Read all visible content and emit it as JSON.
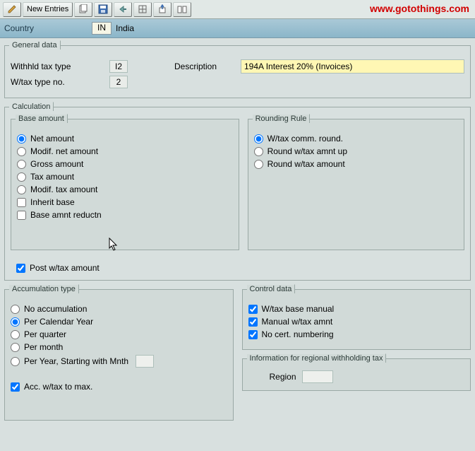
{
  "toolbar": {
    "new_entries": "New Entries"
  },
  "watermark": "www.gotothings.com",
  "countrybar": {
    "label": "Country",
    "code": "IN",
    "name": "India"
  },
  "general": {
    "legend": "General data",
    "withhld_label": "Withhld tax type",
    "withhld_value": "I2",
    "wtaxno_label": "W/tax type no.",
    "wtaxno_value": "2",
    "desc_label": "Description",
    "desc_value": "194A Interest 20% (Invoices)"
  },
  "calc": {
    "legend": "Calculation",
    "base": {
      "legend": "Base amount",
      "options": [
        "Net amount",
        "Modif. net amount",
        "Gross amount",
        "Tax amount",
        "Modif. tax amount"
      ],
      "inherit_label": "Inherit base",
      "reductn_label": "Base amnt reductn"
    },
    "rounding": {
      "legend": "Rounding Rule",
      "options": [
        "W/tax comm. round.",
        "Round w/tax amnt up",
        "Round w/tax amount"
      ]
    },
    "post_label": "Post w/tax amount"
  },
  "accum": {
    "legend": "Accumulation type",
    "options": [
      "No accumulation",
      "Per Calendar Year",
      "Per quarter",
      "Per month",
      "Per Year, Starting with Mnth"
    ],
    "acc_max_label": "Acc. w/tax to max."
  },
  "control": {
    "legend": "Control data",
    "wtax_base_manual": "W/tax base manual",
    "manual_wtax_amnt": "Manual w/tax amnt",
    "no_cert_numbering": "No cert. numbering"
  },
  "regional": {
    "legend": "Information for regional withholding tax",
    "region_label": "Region"
  }
}
